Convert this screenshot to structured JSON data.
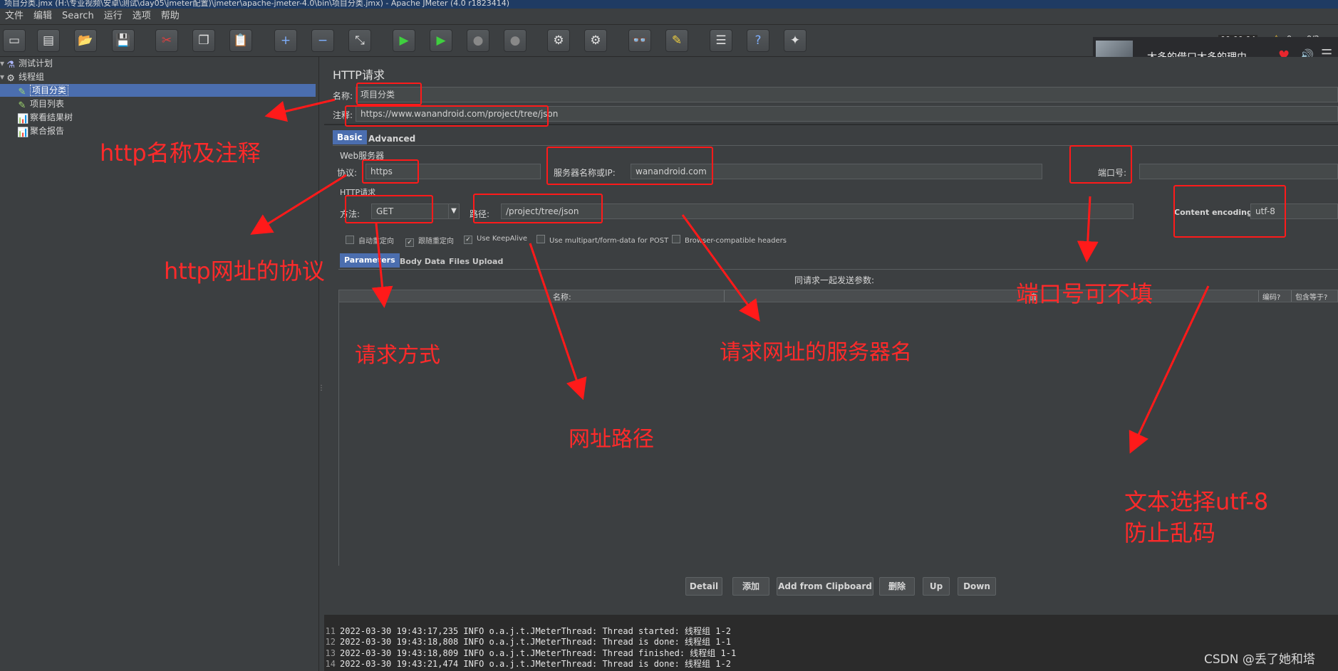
{
  "window": {
    "title": "项目分类.jmx (H:\\专业视频\\安卓\\测试\\day05\\jmeter配置)\\jmeter\\apache-jmeter-4.0\\bin\\项目分类.jmx) - Apache JMeter (4.0 r1823414)"
  },
  "menu": [
    "文件",
    "编辑",
    "Search",
    "运行",
    "选项",
    "帮助"
  ],
  "toolbar": {
    "status_time": "00:00:04",
    "warning_count": "0",
    "threads": "0/2"
  },
  "music_popup": {
    "song": "太多的借口太多的理由"
  },
  "tree": {
    "items": [
      {
        "label": "测试计划",
        "icon": "test-plan-icon"
      },
      {
        "label": "线程组",
        "icon": "gear-icon"
      },
      {
        "label": "项目分类",
        "icon": "pipette-icon"
      },
      {
        "label": "项目列表",
        "icon": "pipette-icon"
      },
      {
        "label": "察看结果树",
        "icon": "chart-icon"
      },
      {
        "label": "聚合报告",
        "icon": "chart-icon"
      }
    ]
  },
  "form": {
    "heading": "HTTP请求",
    "name_label": "名称:",
    "name_value": "项目分类",
    "comment_label": "注释:",
    "comment_value": "https://www.wanandroid.com/project/tree/json",
    "tabs": [
      "Basic",
      "Advanced"
    ],
    "web_server_title": "Web服务器",
    "protocol_label": "协议:",
    "protocol_value": "https",
    "server_label": "服务器名称或IP:",
    "server_value": "wanandroid.com",
    "port_label": "端口号:",
    "port_value": "",
    "http_request_title": "HTTP请求",
    "method_label": "方法:",
    "method_value": "GET",
    "path_label": "路径:",
    "path_value": "/project/tree/json",
    "encoding_label": "Content encoding:",
    "encoding_value": "utf-8",
    "checkboxes": [
      {
        "label": "自动重定向",
        "checked": false
      },
      {
        "label": "跟随重定向",
        "checked": true
      },
      {
        "label": "Use KeepAlive",
        "checked": true
      },
      {
        "label": "Use multipart/form-data for POST",
        "checked": false
      },
      {
        "label": "Browser-compatible headers",
        "checked": false
      }
    ],
    "param_tabs": [
      "Parameters",
      "Body Data",
      "Files Upload"
    ],
    "params_caption": "同请求一起发送参数:",
    "columns": [
      "名称:",
      "值",
      "编码?",
      "包含等于?"
    ],
    "buttons": [
      "Detail",
      "添加",
      "Add from Clipboard",
      "删除",
      "Up",
      "Down"
    ]
  },
  "log": [
    {
      "n": "11",
      "text": "2022-03-30 19:43:17,235 INFO o.a.j.t.JMeterThread: Thread started: 线程组 1-2"
    },
    {
      "n": "12",
      "text": "2022-03-30 19:43:18,808 INFO o.a.j.t.JMeterThread: Thread is done: 线程组 1-1"
    },
    {
      "n": "13",
      "text": "2022-03-30 19:43:18,809 INFO o.a.j.t.JMeterThread: Thread finished: 线程组 1-1"
    },
    {
      "n": "14",
      "text": "2022-03-30 19:43:21,474 INFO o.a.j.t.JMeterThread: Thread is done: 线程组 1-2"
    }
  ],
  "annotations": {
    "name_comment": "http名称及注释",
    "protocol": "http网址的协议",
    "method": "请求方式",
    "server": "请求网址的服务器名",
    "path": "网址路径",
    "port": "端口号可不填",
    "encoding_line1": "文本选择utf-8",
    "encoding_line2": "防止乱码"
  },
  "watermark": "CSDN @丢了她和塔",
  "colors": {
    "annotation_red": "#ff2a2a",
    "selection_blue": "#4b6eaf",
    "panel_bg": "#3c3f41"
  }
}
